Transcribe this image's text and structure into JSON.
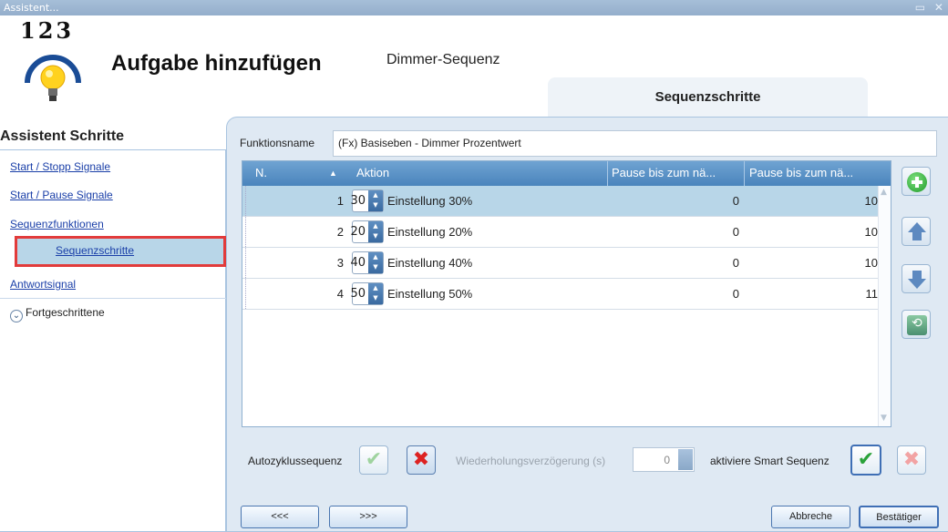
{
  "window": {
    "title": "Assistent...",
    "controls": "▭ ✕"
  },
  "header": {
    "logo_numbers": "123",
    "title": "Aufgabe hinzufügen",
    "subtitle": "Dimmer-Sequenz",
    "tab_label": "Sequenzschritte"
  },
  "sidebar": {
    "title": "Assistent Schritte",
    "items": [
      {
        "label": "Start / Stopp Signale"
      },
      {
        "label": "Start / Pause Signale"
      },
      {
        "label": "Sequenzfunktionen"
      },
      {
        "label": "Sequenzschritte"
      },
      {
        "label": "Antwortsignal"
      }
    ],
    "advanced_label": "Fortgeschrittene"
  },
  "form": {
    "function_name_label": "Funktionsname",
    "function_name_value": "(Fx) Basiseben - Dimmer Prozentwert"
  },
  "table": {
    "columns": [
      "N.",
      "Aktion",
      "Pause bis zum nä...",
      "Pause bis zum nä..."
    ],
    "sort_indicator": "▲",
    "rows": [
      {
        "n": "1",
        "value": "30",
        "action": "Einstellung 30%",
        "pause1": "0",
        "pause2": "10"
      },
      {
        "n": "2",
        "value": "20",
        "action": "Einstellung 20%",
        "pause1": "0",
        "pause2": "10"
      },
      {
        "n": "3",
        "value": "40",
        "action": "Einstellung 40%",
        "pause1": "0",
        "pause2": "10"
      },
      {
        "n": "4",
        "value": "50",
        "action": "Einstellung 50%",
        "pause1": "0",
        "pause2": "11"
      }
    ],
    "selected_row": 0
  },
  "actions": {
    "add_icon": "plus-circle-icon",
    "up_icon": "arrow-up-icon",
    "down_icon": "arrow-down-icon",
    "delete_icon": "recycle-bin-icon"
  },
  "options": {
    "autocycle_label": "Autozyklussequenz",
    "repeat_delay_label": "Wiederholungsverzögerung (s)",
    "repeat_delay_value": "0",
    "smart_sequence_label": "aktiviere Smart Sequenz",
    "check_glyph": "✔",
    "cross_glyph": "✖"
  },
  "footer": {
    "prev_label": "<<<",
    "next_label": ">>>",
    "cancel_label": "Abbreche",
    "confirm_label": "Bestätiger"
  },
  "colors": {
    "selection": "#b8d6e8",
    "highlight_border": "#e23b3b",
    "header_blue": "#4a84bc",
    "panel_bg": "#dfe9f3"
  }
}
